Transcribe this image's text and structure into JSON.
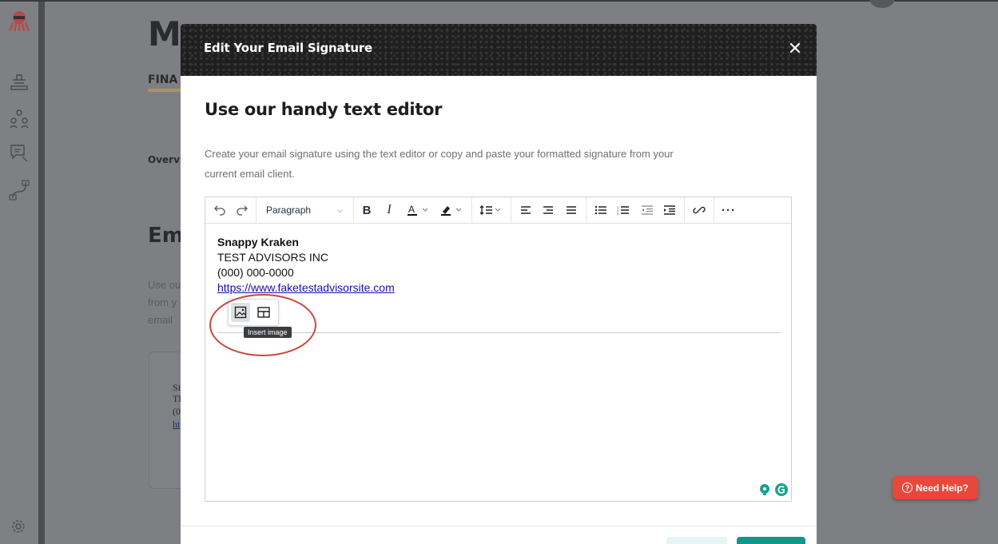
{
  "background": {
    "title": "My",
    "subtitle": "FINA",
    "overview": "Overvi",
    "section_title": "Ema",
    "paragraph": [
      "Use ou",
      "from y",
      "email"
    ],
    "card_lines": [
      "Si",
      "Tl",
      "(0",
      "ht"
    ]
  },
  "sidebar": {
    "icons": [
      "kraken-logo-icon",
      "inbox-icon",
      "people-icon",
      "chat-icon",
      "integrations-icon",
      "settings-icon"
    ]
  },
  "modal": {
    "title": "Edit Your Email Signature",
    "close_label": "✕",
    "heading": "Use our handy text editor",
    "description_line1": "Create your email signature using the text editor or copy and paste your formatted signature from your",
    "description_line2": "current email client."
  },
  "toolbar": {
    "block_format": "Paragraph",
    "buttons": [
      "undo",
      "redo",
      "bold",
      "italic",
      "text-color",
      "highlight",
      "line-height",
      "align-left",
      "align-center",
      "align-justify",
      "bullet-list",
      "numbered-list",
      "outdent",
      "indent",
      "link",
      "more"
    ]
  },
  "signature": {
    "name": "Snappy Kraken",
    "company": "TEST ADVISORS INC",
    "phone": "(000) 000-0000",
    "website": "https://www.faketestadvisorsite.com"
  },
  "quick_insert": {
    "tooltip": "Insert image"
  },
  "help_button": {
    "label": "Need Help?"
  },
  "colors": {
    "header_bg": "#1f1f1f",
    "accent_teal": "#14958a",
    "help_red": "#e8473a",
    "annotation_red": "#c9473f"
  }
}
